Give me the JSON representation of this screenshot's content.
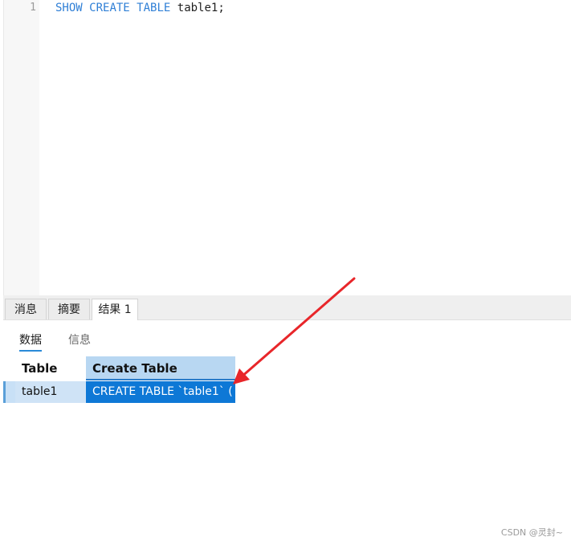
{
  "editor": {
    "line_number": "1",
    "code": {
      "kw1": "SHOW",
      "kw2": "CREATE",
      "kw3": "TABLE",
      "rest": "table1;"
    }
  },
  "result_tabs": [
    "消息",
    "摘要",
    "结果 1"
  ],
  "sub_tabs": [
    "数据",
    "信息"
  ],
  "grid": {
    "columns": [
      "Table",
      "Create Table"
    ],
    "row": [
      "table1",
      "CREATE TABLE `table1` ("
    ]
  },
  "watermark": "CSDN @灵封~",
  "colors": {
    "keyword": "#2f7fd6",
    "selected_cell": "#0e78d6",
    "selected_header": "#b8d7f2",
    "arrow": "#e8262a"
  }
}
